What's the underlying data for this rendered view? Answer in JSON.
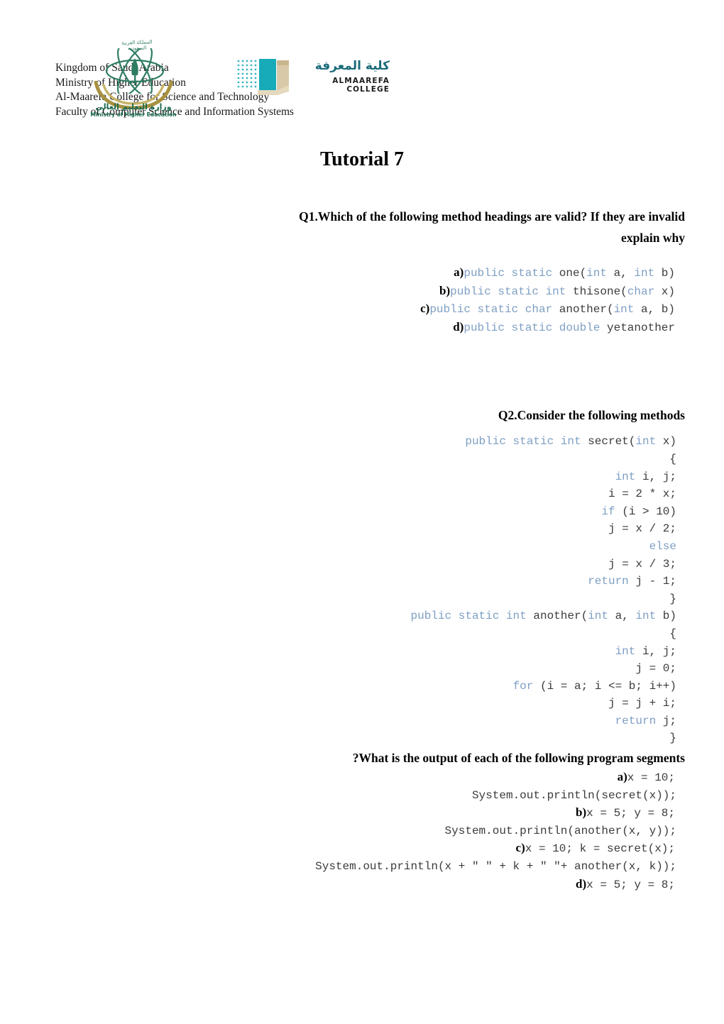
{
  "letterhead": {
    "lines": [
      "Kingdom of Saudi Arabia",
      "Ministry of Higher Education",
      "Al-Maarefa College for Science and Technology",
      "Faculty of Computer Science and Information Systems"
    ],
    "ksa_logo": {
      "arabic_top": "المملكة العربية السعودية",
      "arabic": "وزارة التعليم العالي",
      "english": "Ministry of Higher Education",
      "color": "#1b6b4f"
    },
    "almaarefa_logo": {
      "arabic": "كلية المعرفة",
      "english": "ALMAAREFA COLLEGE",
      "color": "#1b9aa8"
    }
  },
  "title": "Tutorial 7",
  "questions": {
    "q1": {
      "heading": "Q1.Which of the following method headings are valid? If they are invalid",
      "heading_line2": "explain why",
      "items": [
        {
          "mark": "a)",
          "segments": [
            {
              "text": "public static ",
              "kind": "kw"
            },
            {
              "text": "one(",
              "kind": "plain"
            },
            {
              "text": "int ",
              "kind": "kw"
            },
            {
              "text": "a, ",
              "kind": "plain"
            },
            {
              "text": "int ",
              "kind": "kw"
            },
            {
              "text": "b)",
              "kind": "plain"
            }
          ]
        },
        {
          "mark": "b)",
          "segments": [
            {
              "text": "public static int ",
              "kind": "kw"
            },
            {
              "text": "thisone(",
              "kind": "plain"
            },
            {
              "text": "char ",
              "kind": "kw"
            },
            {
              "text": "x)",
              "kind": "plain"
            }
          ]
        },
        {
          "mark": "c)",
          "segments": [
            {
              "text": "public static char ",
              "kind": "kw"
            },
            {
              "text": "another(",
              "kind": "plain"
            },
            {
              "text": "int ",
              "kind": "kw"
            },
            {
              "text": "a, b)",
              "kind": "plain"
            }
          ]
        },
        {
          "mark": "d)",
          "segments": [
            {
              "text": "public static double ",
              "kind": "kw"
            },
            {
              "text": "yetanother",
              "kind": "plain"
            }
          ]
        }
      ]
    },
    "q2": {
      "heading": "Q2.Consider the following methods",
      "method1": [
        {
          "mark": "",
          "segments": [
            {
              "text": "public static int ",
              "kind": "kw"
            },
            {
              "text": "secret(",
              "kind": "plain"
            },
            {
              "text": "int ",
              "kind": "kw"
            },
            {
              "text": "x)",
              "kind": "plain"
            }
          ]
        },
        {
          "mark": "",
          "segments": [
            {
              "text": "{",
              "kind": "plain"
            }
          ]
        },
        {
          "mark": "",
          "segments": [
            {
              "text": "int ",
              "kind": "kw"
            },
            {
              "text": "i, j;",
              "kind": "plain"
            }
          ]
        },
        {
          "mark": "",
          "segments": [
            {
              "text": "i = 2 * x;",
              "kind": "plain"
            }
          ]
        },
        {
          "mark": "",
          "segments": [
            {
              "text": "if ",
              "kind": "kw"
            },
            {
              "text": "(i > 10)",
              "kind": "plain"
            }
          ]
        },
        {
          "mark": "",
          "segments": [
            {
              "text": "j = x / 2;",
              "kind": "plain"
            }
          ]
        },
        {
          "mark": "",
          "segments": [
            {
              "text": "else",
              "kind": "kw"
            }
          ]
        },
        {
          "mark": "",
          "segments": [
            {
              "text": "j = x / 3;",
              "kind": "plain"
            }
          ]
        },
        {
          "mark": "",
          "segments": [
            {
              "text": "return ",
              "kind": "kw"
            },
            {
              "text": "j - 1;",
              "kind": "plain"
            }
          ]
        },
        {
          "mark": "",
          "segments": [
            {
              "text": "}",
              "kind": "plain"
            }
          ]
        }
      ],
      "method2": [
        {
          "mark": "",
          "segments": [
            {
              "text": "public static int ",
              "kind": "kw"
            },
            {
              "text": "another(",
              "kind": "plain"
            },
            {
              "text": "int ",
              "kind": "kw"
            },
            {
              "text": "a, ",
              "kind": "plain"
            },
            {
              "text": "int ",
              "kind": "kw"
            },
            {
              "text": "b)",
              "kind": "plain"
            }
          ]
        },
        {
          "mark": "",
          "segments": [
            {
              "text": "{",
              "kind": "plain"
            }
          ]
        },
        {
          "mark": "",
          "segments": [
            {
              "text": "int ",
              "kind": "kw"
            },
            {
              "text": "i, j;",
              "kind": "plain"
            }
          ]
        },
        {
          "mark": "",
          "segments": [
            {
              "text": "j = 0;",
              "kind": "plain"
            }
          ]
        },
        {
          "mark": "",
          "segments": [
            {
              "text": "for ",
              "kind": "kw"
            },
            {
              "text": "(i = a; i <= b; i++)",
              "kind": "plain"
            }
          ]
        },
        {
          "mark": "",
          "segments": [
            {
              "text": "j = j + i;",
              "kind": "plain"
            }
          ]
        },
        {
          "mark": "",
          "segments": [
            {
              "text": "return ",
              "kind": "kw"
            },
            {
              "text": "j;",
              "kind": "plain"
            }
          ]
        },
        {
          "mark": "",
          "segments": [
            {
              "text": "}",
              "kind": "plain"
            }
          ]
        }
      ],
      "output_heading": "What is the output of each of the following program segments?",
      "segments_list": [
        {
          "mark": "a)",
          "lines": [
            [
              {
                "text": "x = 10;",
                "kind": "plain"
              }
            ],
            [
              {
                "text": "System.out.println(secret(x));",
                "kind": "plain"
              }
            ]
          ]
        },
        {
          "mark": "b)",
          "lines": [
            [
              {
                "text": "x = 5; y = 8;",
                "kind": "plain"
              }
            ],
            [
              {
                "text": "System.out.println(another(x, y));",
                "kind": "plain"
              }
            ]
          ]
        },
        {
          "mark": "c)",
          "lines": [
            [
              {
                "text": "x = 10; k = secret(x);",
                "kind": "plain"
              }
            ],
            [
              {
                "text": "System.out.println(x + \" \" + k + \" \"+ another(x, k));",
                "kind": "plain"
              }
            ]
          ]
        },
        {
          "mark": "d)",
          "lines": [
            [
              {
                "text": "x = 5; y = 8;",
                "kind": "plain"
              }
            ]
          ]
        }
      ]
    }
  }
}
